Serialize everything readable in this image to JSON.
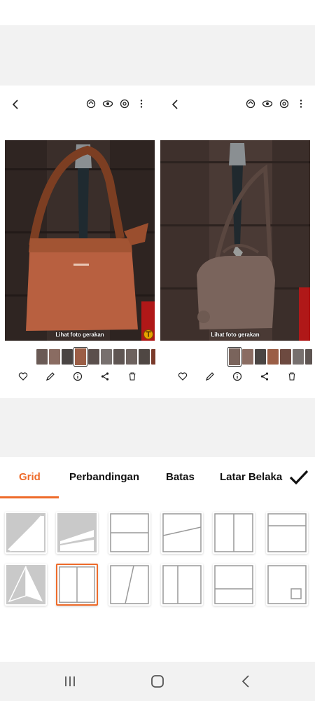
{
  "left_pane": {
    "motion_photo_label": "Lihat foto gerakan",
    "top_icons": [
      "remaster-icon",
      "eye-icon",
      "bixby-vision-icon",
      "more-vert-icon"
    ],
    "actions": [
      "heart-icon",
      "pencil-icon",
      "info-icon",
      "share-icon",
      "trash-icon"
    ]
  },
  "right_pane": {
    "motion_photo_label": "Lihat foto gerakan",
    "top_icons": [
      "remaster-icon",
      "eye-icon",
      "bixby-vision-icon",
      "more-vert-icon"
    ],
    "actions": [
      "heart-icon",
      "pencil-icon",
      "info-icon",
      "share-icon",
      "trash-icon"
    ]
  },
  "tabs": [
    {
      "label": "Grid",
      "active": true
    },
    {
      "label": "Perbandingan",
      "active": false
    },
    {
      "label": "Batas",
      "active": false
    },
    {
      "label": "Latar Belakang",
      "active": false
    }
  ],
  "colors": {
    "accent": "#ee6b2a",
    "bag_brown": "#b55e3a",
    "bag_grey": "#6e5a52"
  },
  "grid_layouts": {
    "selected": "vertical-split",
    "row1": [
      "diagonal-triangle",
      "diagonal-wedge",
      "horizontal-split",
      "slanted-horizontal",
      "vertical-split",
      "horizontal-split-top"
    ],
    "row2": [
      "kite-split",
      "vertical-split",
      "slanted-vertical",
      "vertical-split-narrow",
      "horizontal-split-wide",
      "picture-in-picture"
    ]
  }
}
